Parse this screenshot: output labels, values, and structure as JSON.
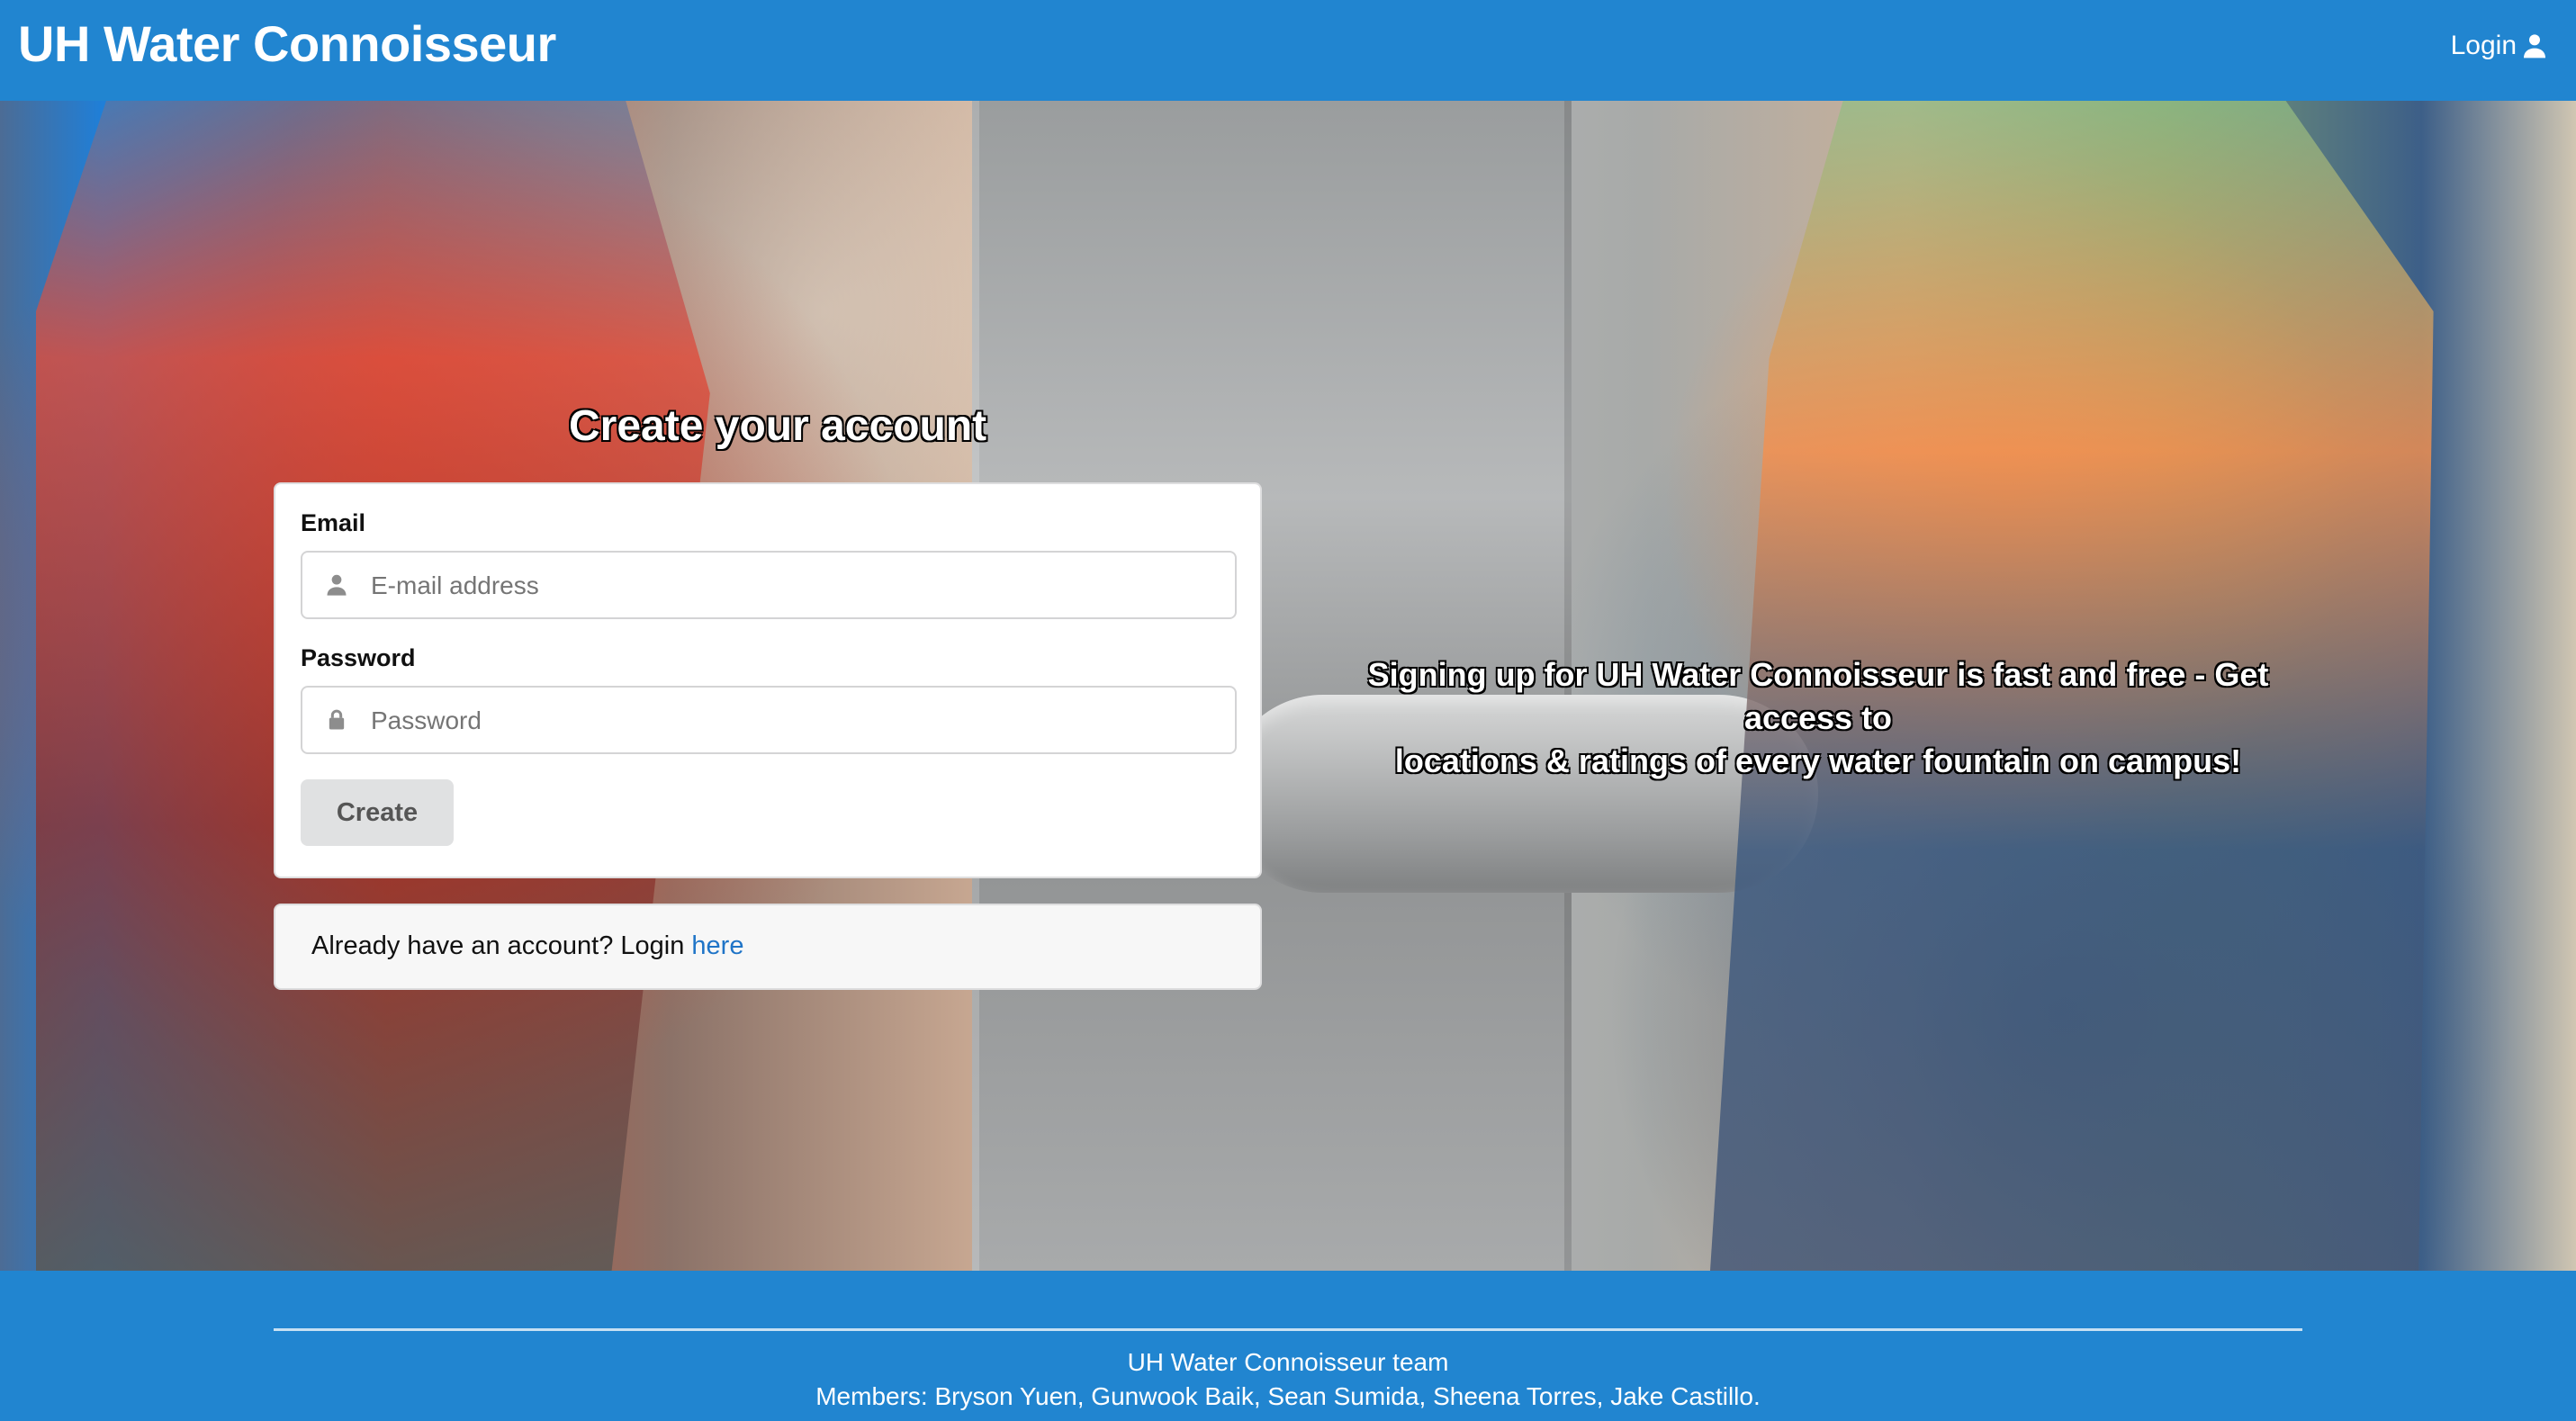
{
  "header": {
    "brand": "UH Water Connoisseur",
    "login_label": "Login",
    "login_icon": "user-icon"
  },
  "signup": {
    "title": "Create your account",
    "email_label": "Email",
    "email_placeholder": "E-mail address",
    "email_icon": "user-icon",
    "password_label": "Password",
    "password_placeholder": "Password",
    "password_icon": "lock-icon",
    "create_label": "Create",
    "login_prompt": "Already have an account? Login",
    "login_link": "here"
  },
  "promo": {
    "line1": "Signing up for UH Water Connoisseur is fast and free - Get access to",
    "line2": "locations & ratings of every water fountain on campus!"
  },
  "footer": {
    "team": "UH Water Connoisseur team",
    "members": "Members: Bryson Yuen, Gunwook Baik, Sean Sumida, Sheena Torres, Jake Castillo."
  },
  "colors": {
    "primary": "#2185d0",
    "link": "#1f74c7",
    "button": "#e0e1e2"
  }
}
